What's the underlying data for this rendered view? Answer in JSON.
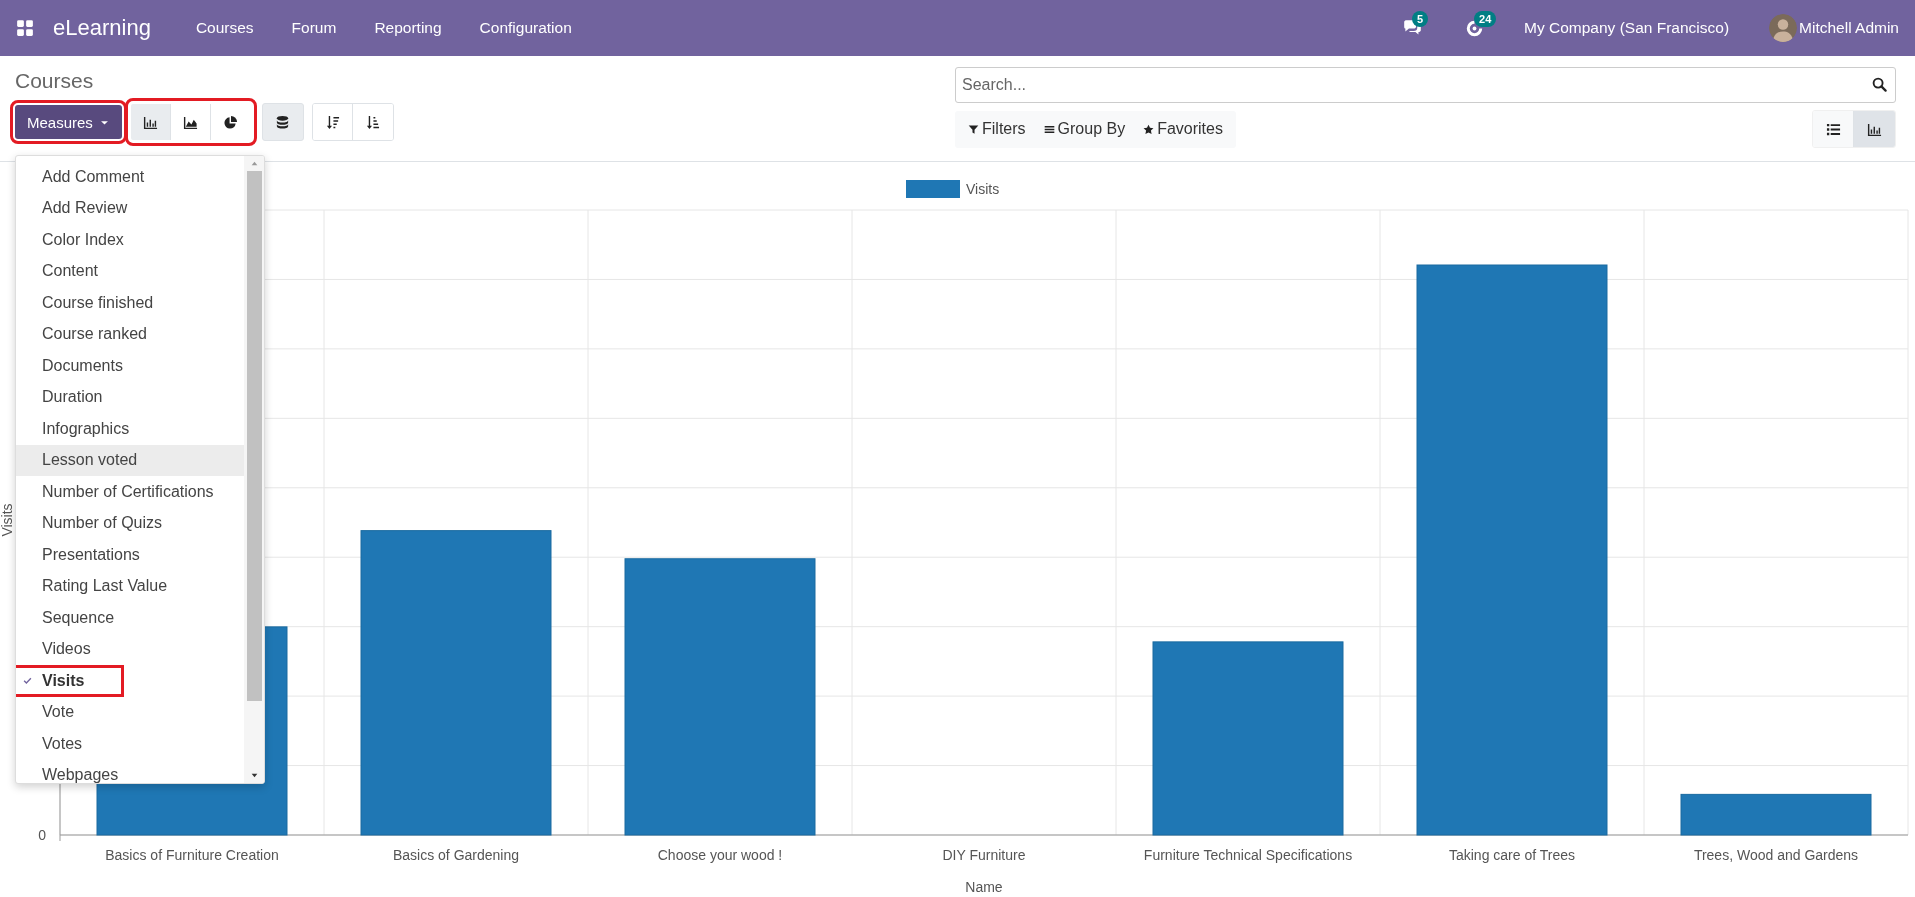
{
  "navbar": {
    "app_name": "eLearning",
    "menu": [
      "Courses",
      "Forum",
      "Reporting",
      "Configuration"
    ],
    "messages_count": "5",
    "activities_count": "24",
    "company": "My Company (San Francisco)",
    "user": "Mitchell Admin"
  },
  "control_panel": {
    "title": "Courses",
    "measures_button": {
      "label": "Measures",
      "highlighted": true
    },
    "chart_types": {
      "highlighted": true,
      "items": [
        {
          "kind": "bar",
          "selected": true
        },
        {
          "kind": "line",
          "selected": false
        },
        {
          "kind": "pie",
          "selected": false
        }
      ]
    },
    "stacked": true,
    "search": {
      "placeholder": "Search..."
    },
    "filters": [
      {
        "kind": "filter",
        "label": "Filters"
      },
      {
        "kind": "group",
        "label": "Group By"
      },
      {
        "kind": "star",
        "label": "Favorites"
      }
    ],
    "views": [
      {
        "kind": "list",
        "selected": false
      },
      {
        "kind": "graph",
        "selected": true
      }
    ]
  },
  "measures_menu": [
    {
      "label": "Add Comment",
      "checked": false,
      "hovered": false,
      "highlighted": false
    },
    {
      "label": "Add Review",
      "checked": false,
      "hovered": false,
      "highlighted": false
    },
    {
      "label": "Color Index",
      "checked": false,
      "hovered": false,
      "highlighted": false
    },
    {
      "label": "Content",
      "checked": false,
      "hovered": false,
      "highlighted": false
    },
    {
      "label": "Course finished",
      "checked": false,
      "hovered": false,
      "highlighted": false
    },
    {
      "label": "Course ranked",
      "checked": false,
      "hovered": false,
      "highlighted": false
    },
    {
      "label": "Documents",
      "checked": false,
      "hovered": false,
      "highlighted": false
    },
    {
      "label": "Duration",
      "checked": false,
      "hovered": false,
      "highlighted": false
    },
    {
      "label": "Infographics",
      "checked": false,
      "hovered": false,
      "highlighted": false
    },
    {
      "label": "Lesson voted",
      "checked": false,
      "hovered": true,
      "highlighted": false
    },
    {
      "label": "Number of Certifications",
      "checked": false,
      "hovered": false,
      "highlighted": false
    },
    {
      "label": "Number of Quizs",
      "checked": false,
      "hovered": false,
      "highlighted": false
    },
    {
      "label": "Presentations",
      "checked": false,
      "hovered": false,
      "highlighted": false
    },
    {
      "label": "Rating Last Value",
      "checked": false,
      "hovered": false,
      "highlighted": false
    },
    {
      "label": "Sequence",
      "checked": false,
      "hovered": false,
      "highlighted": false
    },
    {
      "label": "Videos",
      "checked": false,
      "hovered": false,
      "highlighted": false
    },
    {
      "label": "Visits",
      "checked": true,
      "hovered": false,
      "highlighted": true
    },
    {
      "label": "Vote",
      "checked": false,
      "hovered": false,
      "highlighted": false
    },
    {
      "label": "Votes",
      "checked": false,
      "hovered": false,
      "highlighted": false
    },
    {
      "label": "Webpages",
      "checked": false,
      "hovered": false,
      "highlighted": false
    }
  ],
  "chart": {
    "legend": "Visits",
    "ylabel": "Visits",
    "y_tick": "0",
    "xlabel": "Name",
    "categories": [
      "Basics of Furniture Creation",
      "Basics of Gardening",
      "Choose your wood !",
      "DIY Furniture",
      "Furniture Technical Specifications",
      "Taking care of Trees",
      "Trees, Wood and Gardens"
    ]
  }
}
